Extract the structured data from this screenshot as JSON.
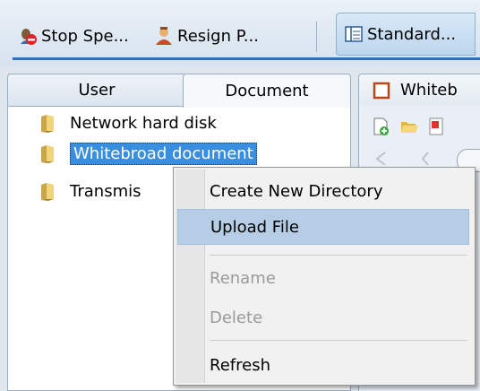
{
  "toolbar": {
    "stop_label": "Stop Spe...",
    "resign_label": "Resign P...",
    "standard_label": "Standard..."
  },
  "tabs": {
    "user": "User",
    "document": "Document",
    "whiteboard": "Whiteb"
  },
  "tree": [
    {
      "label": "Network hard disk",
      "icon": "folder-icon"
    },
    {
      "label": "Whitebroad document",
      "icon": "folder-icon",
      "selected": true
    },
    {
      "label": "Transmis",
      "icon": "folder-icon"
    }
  ],
  "context_menu": {
    "items": [
      {
        "label": "Create New Directory",
        "enabled": true
      },
      {
        "label": "Upload File",
        "enabled": true,
        "highlighted": true
      },
      {
        "label": "Rename",
        "enabled": false
      },
      {
        "label": "Delete",
        "enabled": false
      },
      {
        "label": "Refresh",
        "enabled": true
      }
    ]
  },
  "colors": {
    "selection": "#3a8ee0",
    "menu_highlight": "#b5cde5",
    "toolbar_accent": "#2f6fc0"
  }
}
